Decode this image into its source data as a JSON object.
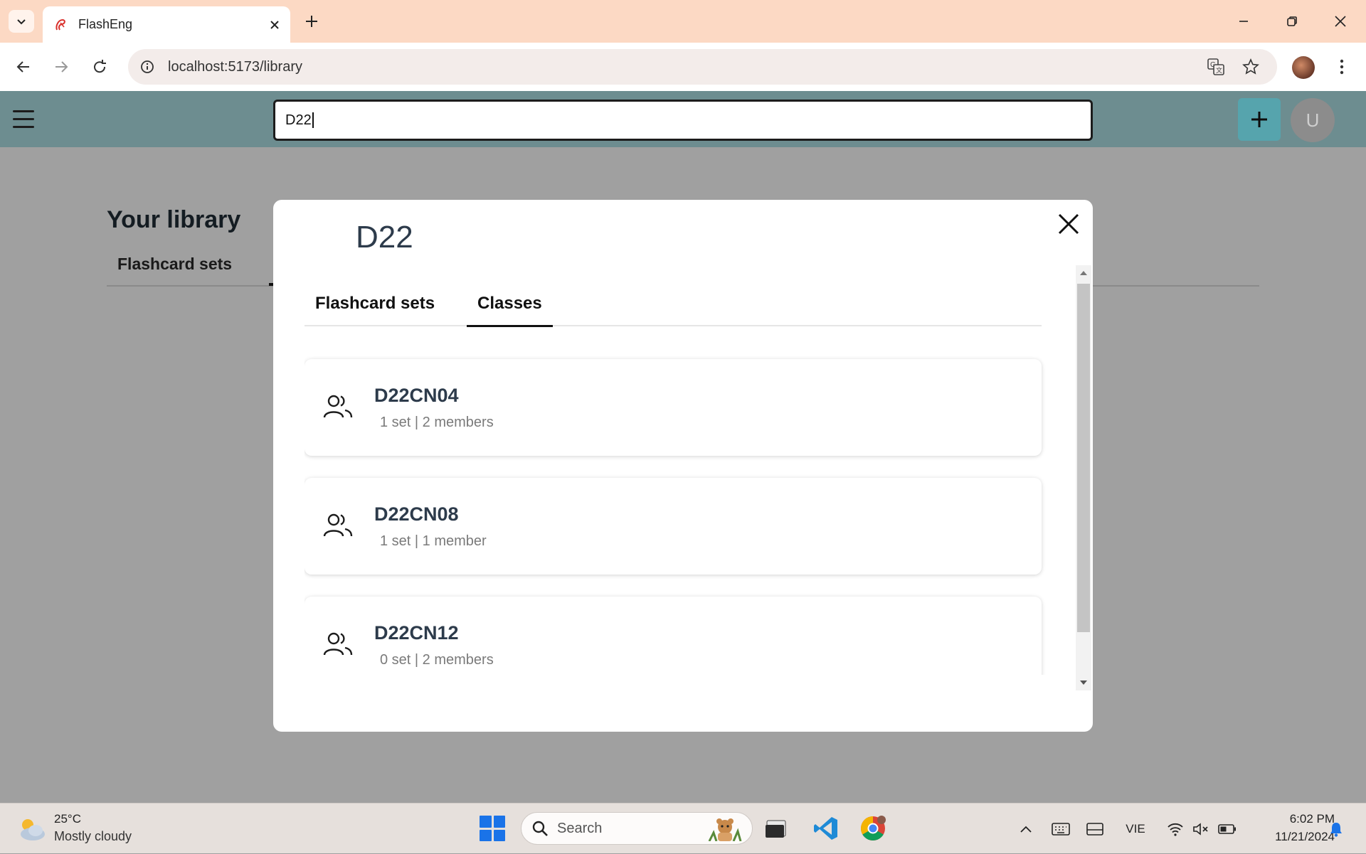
{
  "browser": {
    "tab_title": "FlashEng",
    "url": "localhost:5173/library"
  },
  "app": {
    "search_value": "D22",
    "avatar_initial": "U"
  },
  "page": {
    "title": "Your library",
    "tab_flashcard_sets": "Flashcard sets"
  },
  "modal": {
    "title": "D22",
    "tabs": [
      {
        "label": "Flashcard sets",
        "active": false
      },
      {
        "label": "Classes",
        "active": true
      }
    ],
    "classes": [
      {
        "name": "D22CN04",
        "meta": "1 set | 2 members"
      },
      {
        "name": "D22CN08",
        "meta": "1 set | 1 member"
      },
      {
        "name": "D22CN12",
        "meta": "0 set | 2 members"
      }
    ]
  },
  "taskbar": {
    "weather_temp": "25°C",
    "weather_desc": "Mostly cloudy",
    "search_label": "Search",
    "language": "VIE",
    "time": "6:02 PM",
    "date": "11/21/2024"
  },
  "colors": {
    "tabbar": "#fcd9c4",
    "app_header_dimmed": "#6d8d90",
    "overlay": "#a0a0a0",
    "accent_plus": "#56a4ad",
    "title_text": "#2d3b4b"
  }
}
